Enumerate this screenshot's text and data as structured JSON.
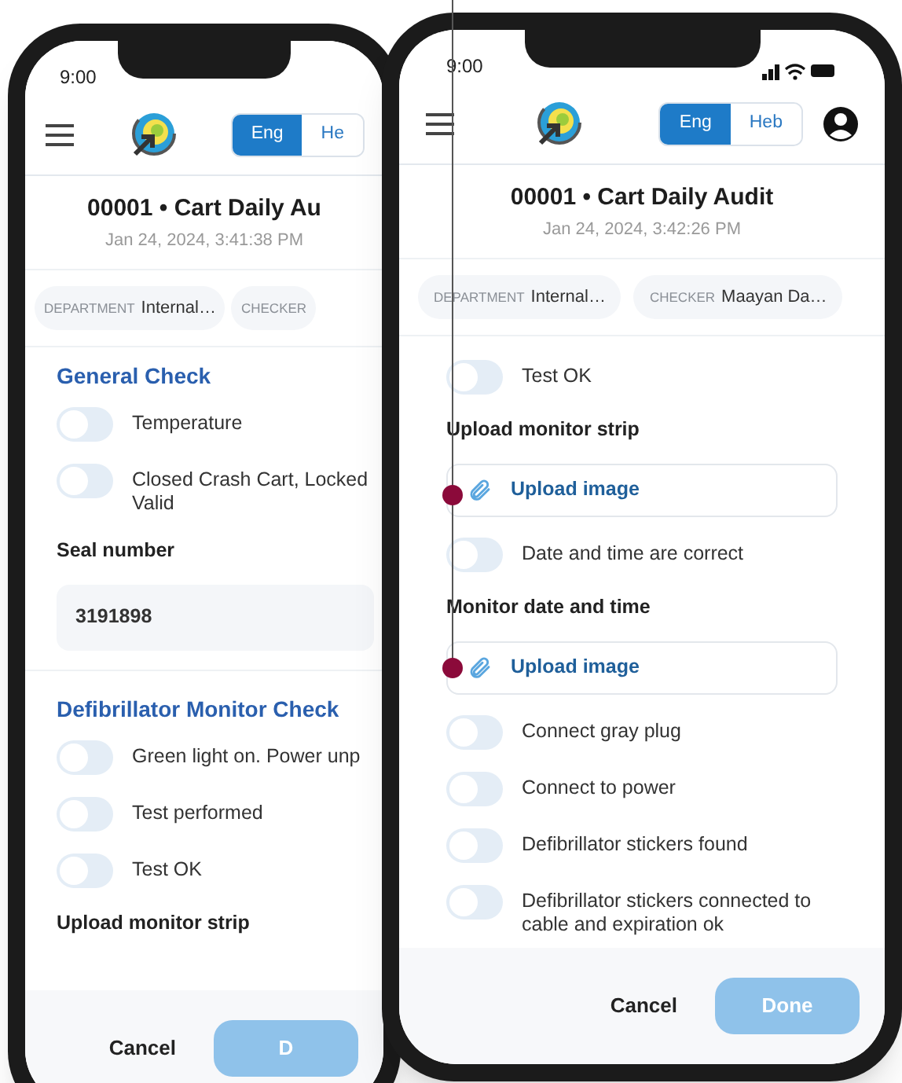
{
  "phones": [
    {
      "status_time": "9:00",
      "status_icons": false,
      "profile_button": false,
      "languages": [
        {
          "label": "Eng",
          "selected": true
        },
        {
          "label": "He",
          "selected": false
        }
      ],
      "title": "00001 • Cart Daily Au",
      "timestamp": "Jan 24, 2024, 3:41:38 PM",
      "fields": [
        {
          "label": "DEPARTMENT",
          "value": "Internal…"
        },
        {
          "label": "CHECKER"
        }
      ],
      "sections": [
        {
          "heading": "General Check",
          "items": [
            {
              "kind": "toggle",
              "label": "Temperature",
              "on": false
            },
            {
              "kind": "toggle",
              "label": "Closed Crash Cart, Locked\nValid",
              "on": false
            },
            {
              "kind": "label",
              "text": "Seal number"
            },
            {
              "kind": "input",
              "value": "3191898"
            }
          ]
        },
        {
          "heading": "Defibrillator Monitor Check",
          "items": [
            {
              "kind": "toggle",
              "label": "Green light on. Power unp",
              "on": false
            },
            {
              "kind": "toggle",
              "label": "Test performed",
              "on": false
            },
            {
              "kind": "toggle",
              "label": "Test OK",
              "on": false
            },
            {
              "kind": "label",
              "text": "Upload monitor strip"
            }
          ]
        }
      ],
      "footer": {
        "cancel": "Cancel",
        "done": "D",
        "done_disabled": true
      }
    },
    {
      "status_time": "9:00",
      "status_icons": true,
      "profile_button": true,
      "languages": [
        {
          "label": "Eng",
          "selected": true
        },
        {
          "label": "Heb",
          "selected": false
        }
      ],
      "title": "00001 • Cart Daily Audit",
      "timestamp": "Jan 24, 2024, 3:42:26 PM",
      "fields": [
        {
          "label": "DEPARTMENT",
          "value": "Internal…"
        },
        {
          "label": "CHECKER",
          "value": "Maayan Da…"
        }
      ],
      "sections": [
        {
          "items": [
            {
              "kind": "toggle",
              "label": "Test OK",
              "on": false
            },
            {
              "kind": "label",
              "text": "Upload monitor strip"
            },
            {
              "kind": "upload",
              "label": "Upload image"
            },
            {
              "kind": "toggle",
              "label": "Date and time are correct",
              "on": false
            },
            {
              "kind": "label",
              "text": "Monitor date and time"
            },
            {
              "kind": "upload",
              "label": "Upload image"
            },
            {
              "kind": "toggle",
              "label": "Connect gray plug",
              "on": false
            },
            {
              "kind": "toggle",
              "label": "Connect to power",
              "on": false
            },
            {
              "kind": "toggle",
              "label": "Defibrillator stickers found",
              "on": false
            },
            {
              "kind": "toggle",
              "label": "Defibrillator stickers connected to cable and expiration ok",
              "on": false
            }
          ]
        }
      ],
      "footer": {
        "cancel": "Cancel",
        "done": "Done",
        "done_disabled": true
      }
    }
  ]
}
